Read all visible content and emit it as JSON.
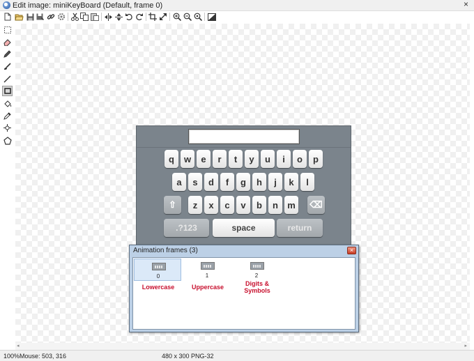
{
  "window": {
    "title": "Edit image: miniKeyBoard (Default, frame 0)",
    "close_glyph": "×"
  },
  "toolbar": {
    "icons": [
      "new-icon",
      "open-icon",
      "save-icon",
      "save-as-icon",
      "link-icon",
      "settings-icon",
      "cut-icon",
      "copy-icon",
      "paste-icon",
      "flip-horizontal-icon",
      "flip-vertical-icon",
      "rotate-left-icon",
      "rotate-right-icon",
      "crop-icon",
      "resize-icon",
      "zoom-in-icon",
      "zoom-out-icon",
      "zoom-actual-icon",
      "color-icon"
    ]
  },
  "tools": [
    "select-rect-icon",
    "eraser-icon",
    "pencil-icon",
    "brush-icon",
    "line-icon",
    "rectangle-icon",
    "fill-icon",
    "eyedropper-icon",
    "crosshair-icon",
    "polygon-icon"
  ],
  "keyboard": {
    "row1": [
      "q",
      "w",
      "e",
      "r",
      "t",
      "y",
      "u",
      "i",
      "o",
      "p"
    ],
    "row2": [
      "a",
      "s",
      "d",
      "f",
      "g",
      "h",
      "j",
      "k",
      "l"
    ],
    "row3": [
      "z",
      "x",
      "c",
      "v",
      "b",
      "n",
      "m"
    ],
    "shift_glyph": "⇧",
    "backspace_glyph": "⌫",
    "numbers_label": ".?123",
    "space_label": "space",
    "return_label": "return"
  },
  "frames_dialog": {
    "title": "Animation frames (3)",
    "close_glyph": "×",
    "frames": [
      {
        "number": "0",
        "label_line1": "Lowercase",
        "label_line2": ""
      },
      {
        "number": "1",
        "label_line1": "Uppercase",
        "label_line2": ""
      },
      {
        "number": "2",
        "label_line1": "Digits &",
        "label_line2": "Symbols"
      }
    ],
    "label_color": "#c8102e"
  },
  "scrollbar": {
    "left_glyph": "◂",
    "right_glyph": "▸"
  },
  "status": {
    "zoom": "100%",
    "mouse": "Mouse: 503, 316",
    "image_info": "480 x 300  PNG-32"
  }
}
